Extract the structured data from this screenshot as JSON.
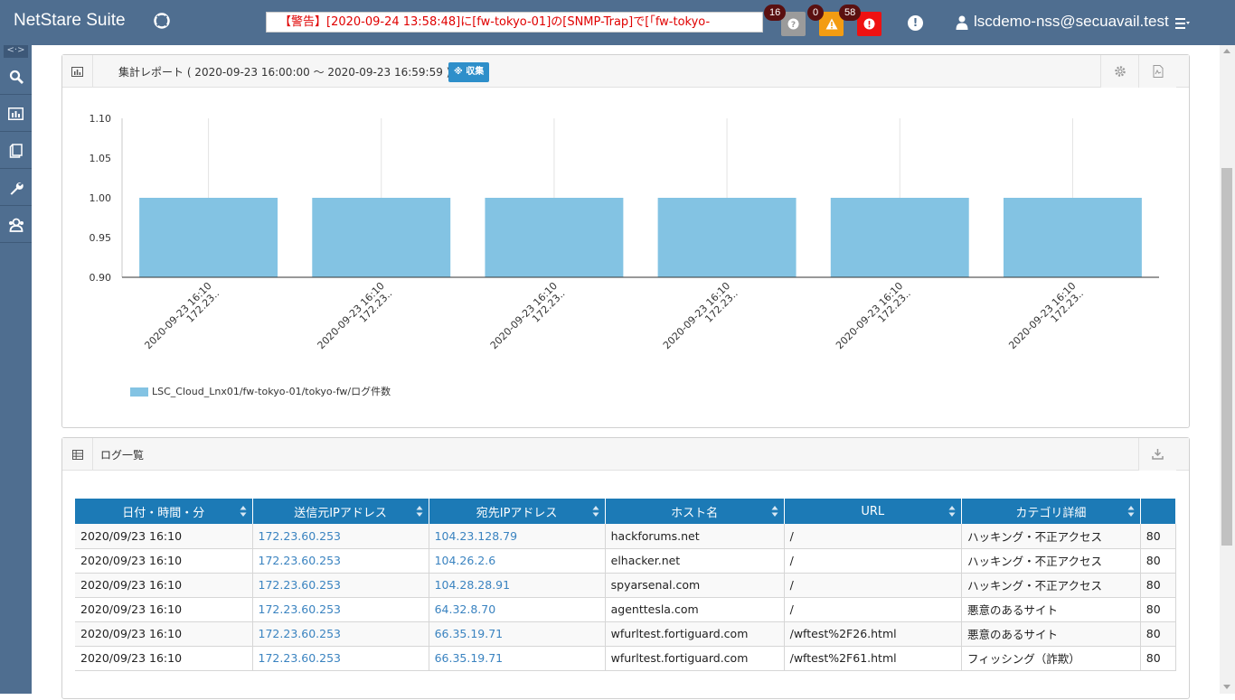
{
  "header": {
    "brand": "NetStare Suite",
    "ticker": "【警告】[2020-09-24 13:58:48]に[fw-tokyo-01]の[SNMP-Trap]で[「fw-tokyo-",
    "alerts": [
      {
        "type": "unknown",
        "count": "16",
        "color": "#9b9b9b"
      },
      {
        "type": "warning",
        "count": "0",
        "color": "#f39c12"
      },
      {
        "type": "error",
        "count": "58",
        "color": "#ee1111"
      }
    ],
    "user": "lscdemo-nss@secuavail.test"
  },
  "sidebar": {
    "toggle": "<·>",
    "items": [
      {
        "icon": "search-icon"
      },
      {
        "icon": "report-icon"
      },
      {
        "icon": "book-icon"
      },
      {
        "icon": "wrench-icon"
      },
      {
        "icon": "users-icon"
      }
    ]
  },
  "report_panel": {
    "title": "集計レポート ( 2020-09-23 16:00:00 〜 2020-09-23 16:59:59 )",
    "collect_label": "※ 収集",
    "legend": "LSC_Cloud_Lnx01/fw-tokyo-01/tokyo-fw/ログ件数"
  },
  "chart_data": {
    "type": "bar",
    "categories": [
      "2020-09-23 16:10 172.23..",
      "2020-09-23 16:10 172.23..",
      "2020-09-23 16:10 172.23..",
      "2020-09-23 16:10 172.23..",
      "2020-09-23 16:10 172.23..",
      "2020-09-23 16:10 172.23.."
    ],
    "category_lines": [
      [
        "2020-09-23 16:10",
        "172.23.."
      ],
      [
        "2020-09-23 16:10",
        "172.23.."
      ],
      [
        "2020-09-23 16:10",
        "172.23.."
      ],
      [
        "2020-09-23 16:10",
        "172.23.."
      ],
      [
        "2020-09-23 16:10",
        "172.23.."
      ],
      [
        "2020-09-23 16:10",
        "172.23.."
      ]
    ],
    "series": [
      {
        "name": "LSC_Cloud_Lnx01/fw-tokyo-01/tokyo-fw/ログ件数",
        "values": [
          1,
          1,
          1,
          1,
          1,
          1
        ],
        "color": "#83c3e3"
      }
    ],
    "ylim": [
      0.9,
      1.1
    ],
    "yticks": [
      "0.90",
      "0.95",
      "1.00",
      "1.05",
      "1.10"
    ],
    "ytick_values": [
      0.9,
      0.95,
      1.0,
      1.05,
      1.1
    ],
    "grid": "vertical",
    "legend_position": "bottom-left",
    "title": "",
    "xlabel": "",
    "ylabel": ""
  },
  "log_panel": {
    "title": "ログ一覧",
    "columns": [
      "日付・時間・分",
      "送信元IPアドレス",
      "宛先IPアドレス",
      "ホスト名",
      "URL",
      "カテゴリ詳細",
      ""
    ],
    "rows": [
      [
        "2020/09/23 16:10",
        "172.23.60.253",
        "104.23.128.79",
        "hackforums.net",
        "/",
        "ハッキング・不正アクセス",
        "80"
      ],
      [
        "2020/09/23 16:10",
        "172.23.60.253",
        "104.26.2.6",
        "elhacker.net",
        "/",
        "ハッキング・不正アクセス",
        "80"
      ],
      [
        "2020/09/23 16:10",
        "172.23.60.253",
        "104.28.28.91",
        "spyarsenal.com",
        "/",
        "ハッキング・不正アクセス",
        "80"
      ],
      [
        "2020/09/23 16:10",
        "172.23.60.253",
        "64.32.8.70",
        "agenttesla.com",
        "/",
        "悪意のあるサイト",
        "80"
      ],
      [
        "2020/09/23 16:10",
        "172.23.60.253",
        "66.35.19.71",
        "wfurltest.fortiguard.com",
        "/wftest%2F26.html",
        "悪意のあるサイト",
        "80"
      ],
      [
        "2020/09/23 16:10",
        "172.23.60.253",
        "66.35.19.71",
        "wfurltest.fortiguard.com",
        "/wftest%2F61.html",
        "フィッシング（詐欺）",
        "80"
      ]
    ]
  }
}
